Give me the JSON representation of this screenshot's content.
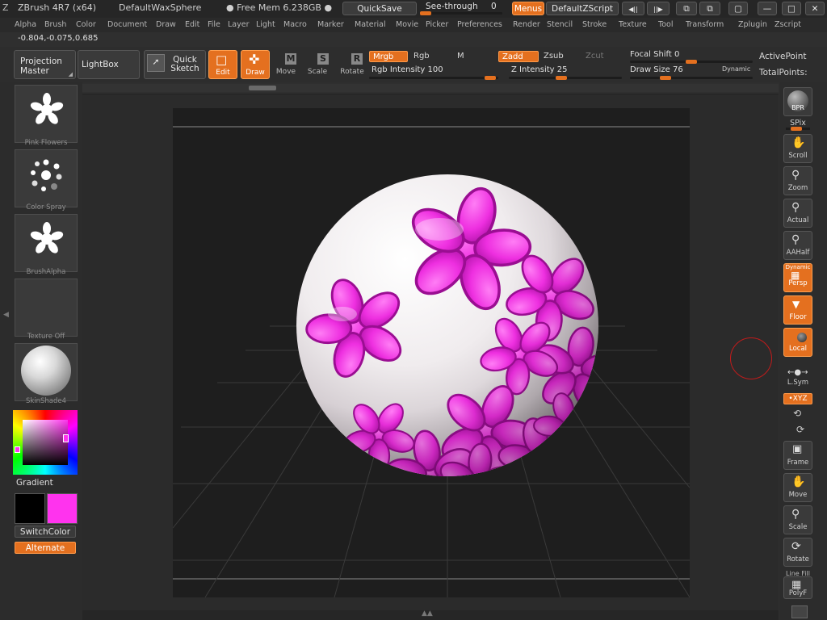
{
  "titlebar": {
    "app": "ZBrush 4R7 (x64)",
    "document": "DefaultWaxSphere",
    "memory": "● Free Mem 6.238GB ●",
    "quicksave": "QuickSave",
    "see_through": "See-through",
    "see_through_value": "0",
    "menus": "Menus",
    "script": "DefaultZScript"
  },
  "menubar": [
    "Alpha",
    "Brush",
    "Color",
    "Document",
    "Draw",
    "Edit",
    "File",
    "Layer",
    "Light",
    "Macro",
    "Marker",
    "Material",
    "Movie",
    "Picker",
    "Preferences",
    "Render",
    "Stencil",
    "Stroke",
    "Texture",
    "Tool",
    "Transform",
    "Zplugin",
    "Zscript"
  ],
  "coords": "-0.804,-0.075,0.685",
  "shelf": {
    "projection_master": "Projection Master",
    "lightbox": "LightBox",
    "quick_sketch": "Quick Sketch",
    "edit": "Edit",
    "draw": "Draw",
    "move": "Move",
    "scale": "Scale",
    "rotate": "Rotate",
    "mrgb": "Mrgb",
    "rgb": "Rgb",
    "m": "M",
    "zadd": "Zadd",
    "zsub": "Zsub",
    "zcut": "Zcut",
    "rgb_intensity": "Rgb Intensity 100",
    "z_intensity": "Z Intensity 25",
    "focal_shift": "Focal Shift 0",
    "draw_size": "Draw Size 76",
    "dynamic": "Dynamic",
    "active_points": "ActivePoint",
    "total_points": "TotalPoints:"
  },
  "left": {
    "brush_label": "Pink Flowers",
    "stroke_label": "Color Spray",
    "alpha_label": "BrushAlpha",
    "texture_label": "Texture Off",
    "material_label": "SkinShade4",
    "gradient": "Gradient",
    "switch_color": "SwitchColor",
    "alternate": "Alternate",
    "colors": {
      "main": "#ff33ee",
      "secondary": "#000000",
      "accent": "#e4701f"
    }
  },
  "right": {
    "bpr": "BPR",
    "spix": "SPix",
    "scroll": "Scroll",
    "zoom": "Zoom",
    "actual": "Actual",
    "aahalf": "AAHalf",
    "dynamic": "Dynamic",
    "persp": "Persp",
    "floor": "Floor",
    "local": "Local",
    "lsym": "L.Sym",
    "xyz": "•XYZ",
    "frame": "Frame",
    "move": "Move",
    "scale": "Scale",
    "rotate": "Rotate",
    "line_fill": "Line Fill",
    "polyf": "PolyF"
  },
  "values": {
    "see_through": 0,
    "rgb_intensity": 100,
    "z_intensity": 25,
    "focal_shift": 0,
    "draw_size": 76
  }
}
